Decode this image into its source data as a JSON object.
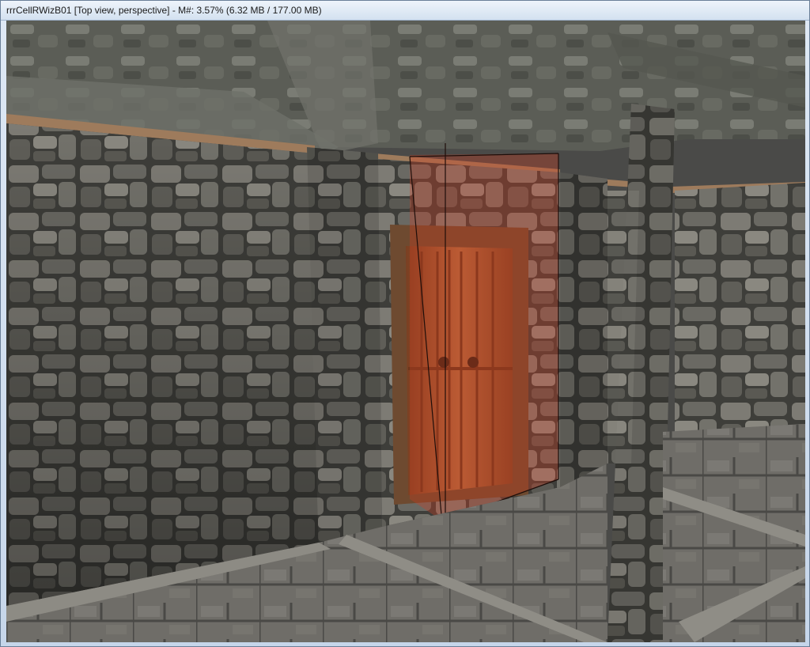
{
  "window": {
    "title": "rrrCellRWizB01 [Top view, perspective] - M#: 3.57% (6.32 MB / 177.00 MB)"
  },
  "viewport": {
    "view_mode": "Top view, perspective",
    "scene": "stone room with wooden double door, selected door highlighted in red"
  },
  "colors": {
    "stone": "#6f6d66",
    "mortar": "#3a3a36",
    "wood": "#9a5a34",
    "selection": "#d23a20",
    "floor": "#6d6b66"
  }
}
